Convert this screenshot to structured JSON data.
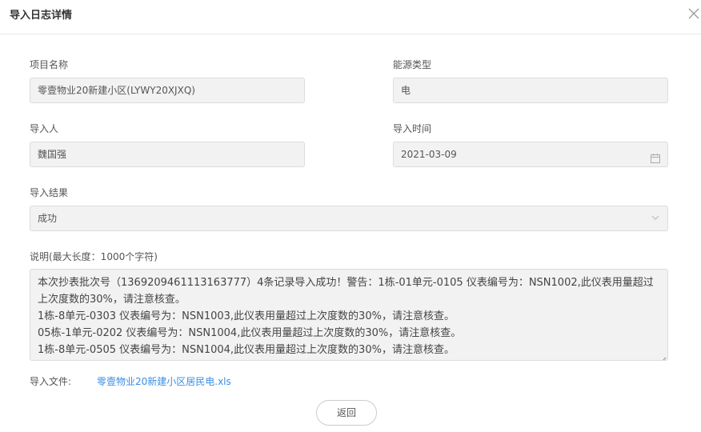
{
  "dialog": {
    "title": "导入日志详情",
    "close_icon": "close-icon"
  },
  "form": {
    "project": {
      "label": "项目名称",
      "value": "零壹物业20新建小区(LYWY20XJXQ)"
    },
    "energy_type": {
      "label": "能源类型",
      "value": "电"
    },
    "importer": {
      "label": "导入人",
      "value": "魏国强"
    },
    "import_time": {
      "label": "导入时间",
      "value": "2021-03-09",
      "icon": "calendar-icon"
    },
    "result": {
      "label": "导入结果",
      "value": "成功",
      "icon": "chevron-down-icon"
    },
    "description": {
      "label": "说明(最大长度：1000个字符)",
      "lines": [
        "本次抄表批次号（1369209461113163777）4条记录导入成功！警告：1栋-01单元-0105 仪表编号为：NSN1002,此仪表用量超过上次度数的30%，请注意核查。",
        "1栋-8单元-0303 仪表编号为：NSN1003,此仪表用量超过上次度数的30%，请注意核查。",
        "05栋-1单元-0202 仪表编号为：NSN1004,此仪表用量超过上次度数的30%，请注意核查。",
        "1栋-8单元-0505 仪表编号为：NSN1004,此仪表用量超过上次度数的30%，请注意核查。"
      ]
    },
    "file": {
      "label": "导入文件:",
      "name": "零壹物业20新建小区居民电.xls"
    }
  },
  "actions": {
    "back_label": "返回"
  }
}
